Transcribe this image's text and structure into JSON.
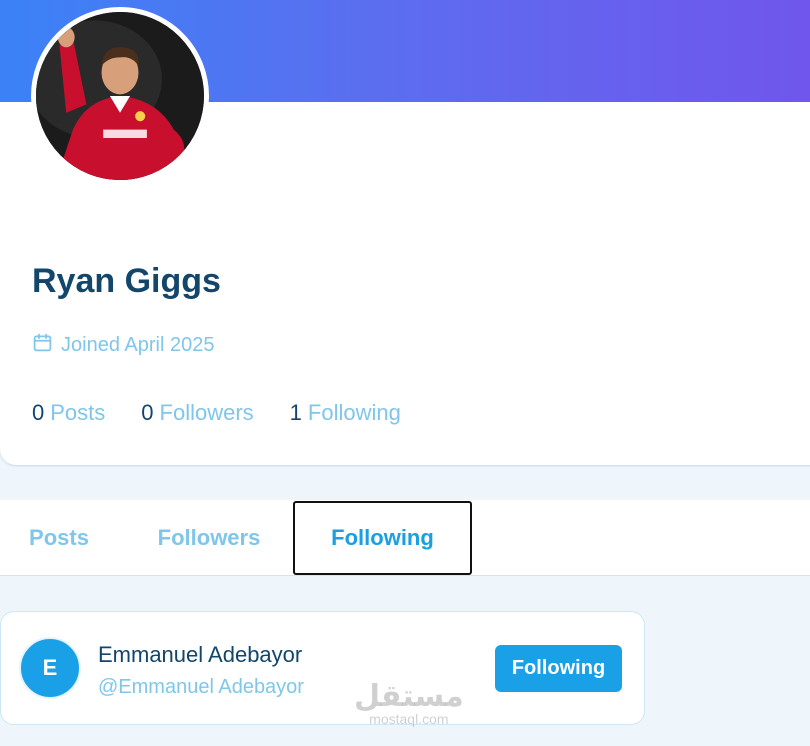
{
  "profile": {
    "name": "Ryan Giggs",
    "joined": "Joined April 2025",
    "stats": [
      {
        "count": "0",
        "label": "Posts"
      },
      {
        "count": "0",
        "label": "Followers"
      },
      {
        "count": "1",
        "label": "Following"
      }
    ]
  },
  "tabs": [
    {
      "label": "Posts"
    },
    {
      "label": "Followers"
    },
    {
      "label": "Following",
      "active": true
    }
  ],
  "following_list": [
    {
      "initial": "E",
      "name": "Emmanuel Adebayor",
      "handle": "@Emmanuel Adebayor",
      "button_label": "Following"
    }
  ],
  "watermark": {
    "main": "مستقل",
    "sub": "mostaql.com"
  },
  "colors": {
    "banner_start": "#3b82f6",
    "banner_end": "#7155ec",
    "accent": "#1aa0e6",
    "name_text": "#12466b",
    "muted_text": "#7fc6ea"
  },
  "icons": {
    "joined": "calendar-icon"
  }
}
